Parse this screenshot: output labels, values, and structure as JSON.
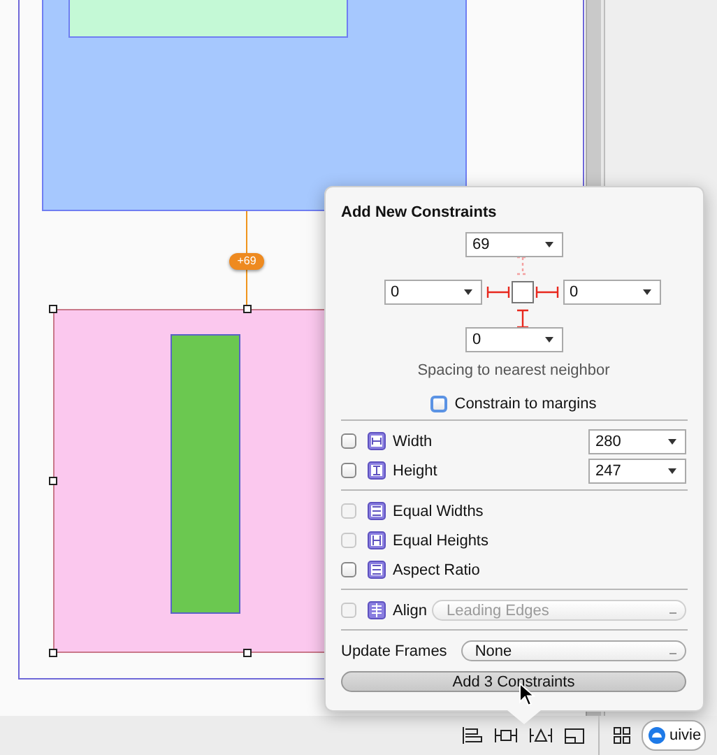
{
  "canvas": {
    "spacing_badge": "+69"
  },
  "popover": {
    "title": "Add New Constraints",
    "spacing": {
      "top": {
        "value": "69",
        "active": false
      },
      "left": {
        "value": "0",
        "active": true
      },
      "right": {
        "value": "0",
        "active": true
      },
      "bottom": {
        "value": "0",
        "active": true
      }
    },
    "spacing_caption": "Spacing to nearest neighbor",
    "constrain_to_margins": {
      "label": "Constrain to margins",
      "checked": false
    },
    "size_rows": [
      {
        "label": "Width",
        "checked": false,
        "value": "280"
      },
      {
        "label": "Height",
        "checked": false,
        "value": "247"
      }
    ],
    "relation_rows": [
      {
        "label": "Equal Widths",
        "checked": false,
        "disabled": true
      },
      {
        "label": "Equal Heights",
        "checked": false,
        "disabled": true
      },
      {
        "label": "Aspect Ratio",
        "checked": false,
        "disabled": false
      }
    ],
    "align": {
      "label": "Align",
      "value": "Leading Edges",
      "checked": false,
      "disabled": true
    },
    "update_frames": {
      "label": "Update Frames",
      "value": "None"
    },
    "add_button": "Add 3 Constraints"
  },
  "toolbar": {
    "scheme_value": "uivie"
  }
}
